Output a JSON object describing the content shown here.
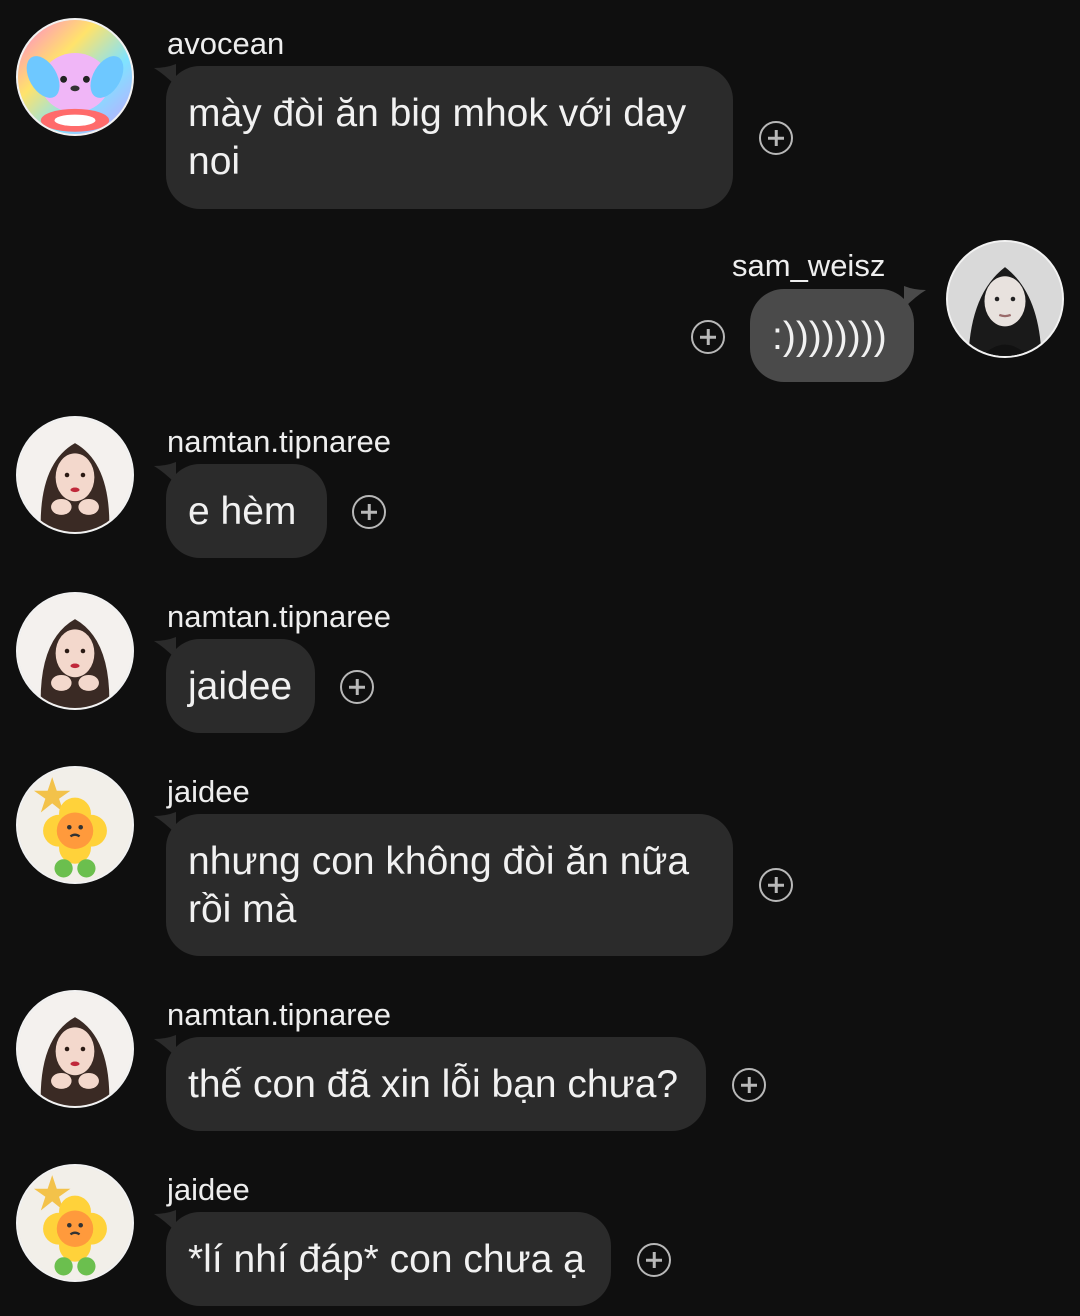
{
  "messages": [
    {
      "username": "avocean",
      "text": "mày đòi ăn big mhok với day noi",
      "side": "left",
      "avatar": "avocean-avatar"
    },
    {
      "username": "sam_weisz",
      "text": ":))))))))",
      "side": "right",
      "avatar": "sam-weisz-avatar"
    },
    {
      "username": "namtan.tipnaree",
      "text": "e hèm",
      "side": "left",
      "avatar": "namtan-avatar"
    },
    {
      "username": "namtan.tipnaree",
      "text": "jaidee",
      "side": "left",
      "avatar": "namtan-avatar"
    },
    {
      "username": "jaidee",
      "text": "nhưng con không đòi ăn nữa rồi mà",
      "side": "left",
      "avatar": "jaidee-avatar"
    },
    {
      "username": "namtan.tipnaree",
      "text": "thế con đã xin lỗi bạn chưa?",
      "side": "left",
      "avatar": "namtan-avatar"
    },
    {
      "username": "jaidee",
      "text": "*lí nhí đáp* con chưa ạ",
      "side": "left",
      "avatar": "jaidee-avatar"
    }
  ],
  "icons": {
    "react": "plus-circle-icon"
  },
  "colors": {
    "background": "#0f0f0f",
    "bubble_left": "#2b2b2b",
    "bubble_right": "#4a4a4a",
    "text": "#f1f1f1"
  }
}
